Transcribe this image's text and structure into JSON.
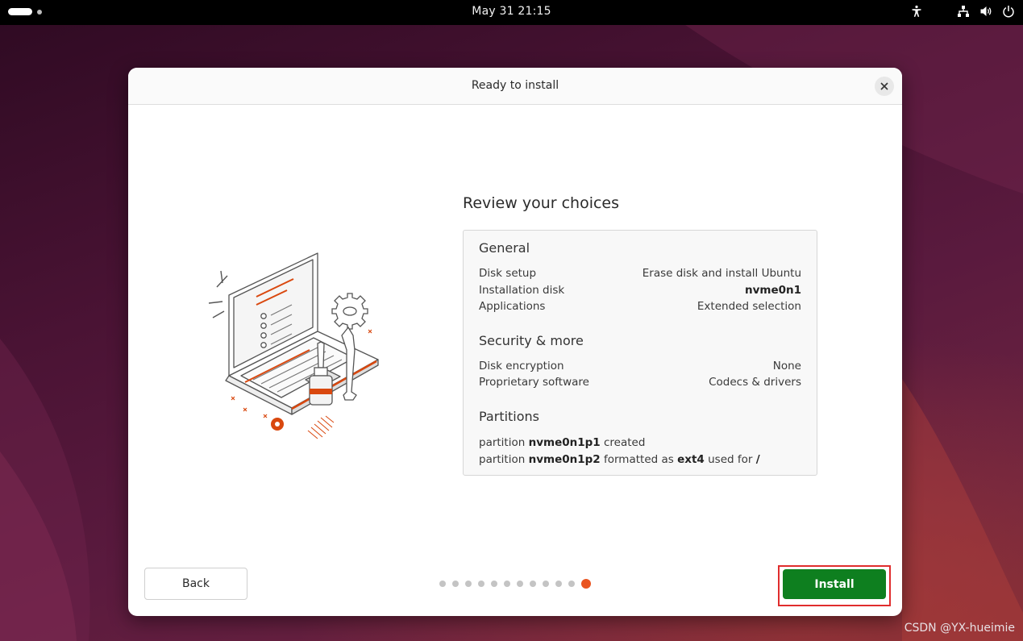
{
  "topbar": {
    "clock": "May 31  21:15",
    "icons": [
      "accessibility-icon",
      "network-icon",
      "volume-icon",
      "power-icon"
    ]
  },
  "dialog": {
    "title": "Ready to install",
    "heading": "Review your choices",
    "general": {
      "title": "General",
      "rows": [
        {
          "label": "Disk setup",
          "value": "Erase disk and install Ubuntu"
        },
        {
          "label": "Installation disk",
          "value": "nvme0n1"
        },
        {
          "label": "Applications",
          "value": "Extended selection"
        }
      ]
    },
    "security": {
      "title": "Security & more",
      "rows": [
        {
          "label": "Disk encryption",
          "value": "None"
        },
        {
          "label": "Proprietary software",
          "value": "Codecs & drivers"
        }
      ]
    },
    "partitions": {
      "title": "Partitions",
      "line1": {
        "prefix": "partition",
        "name": "nvme0n1p1",
        "suffix": "created"
      },
      "line2": {
        "prefix": "partition",
        "name": "nvme0n1p2",
        "mid": "formatted as",
        "fs": "ext4",
        "mid2": "used for",
        "mount": "/"
      }
    },
    "back_label": "Back",
    "install_label": "Install",
    "steps": {
      "total": 12,
      "current": 12
    }
  },
  "colors": {
    "accent": "#e95420",
    "install": "#0e7f1f",
    "highlight": "#e02d2d"
  },
  "watermark": "CSDN @YX-hueimie"
}
